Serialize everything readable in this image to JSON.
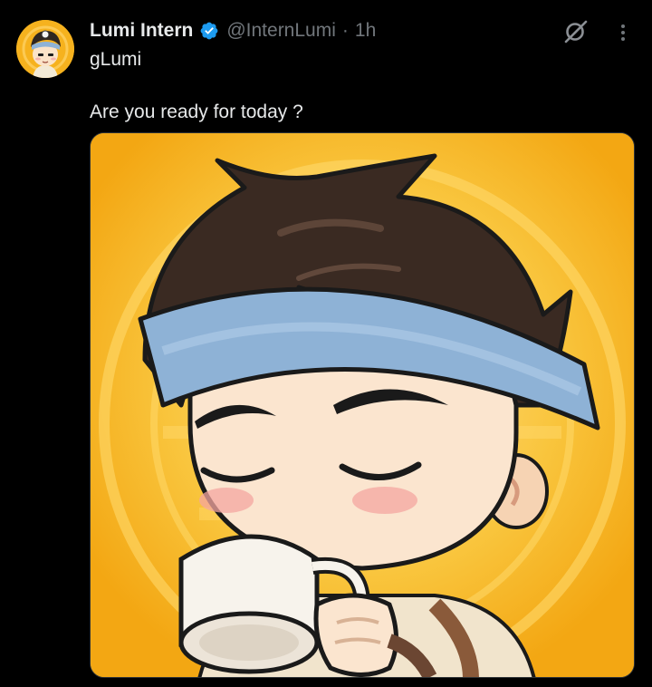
{
  "post": {
    "author": {
      "display_name": "Lumi Intern",
      "handle": "@InternLumi",
      "separator": "·",
      "time": "1h",
      "verified": true,
      "avatar_icon": "chibi-boy-avatar"
    },
    "username_line": "gLumi",
    "text": "Are you ready for today ?",
    "media": {
      "alt_icon": "chibi-boy-drinking-coffee-illustration"
    },
    "actions": {
      "grok_icon": "grok-icon",
      "more_icon": "more-vertical-icon"
    }
  },
  "colors": {
    "background": "#000000",
    "primary_text": "#e7e9ea",
    "secondary_text": "#71767b",
    "verified_blue": "#1d9bf0",
    "image_background": "#f5b51b",
    "headband": "#8eb2d6",
    "hair": "#3a2a22"
  }
}
